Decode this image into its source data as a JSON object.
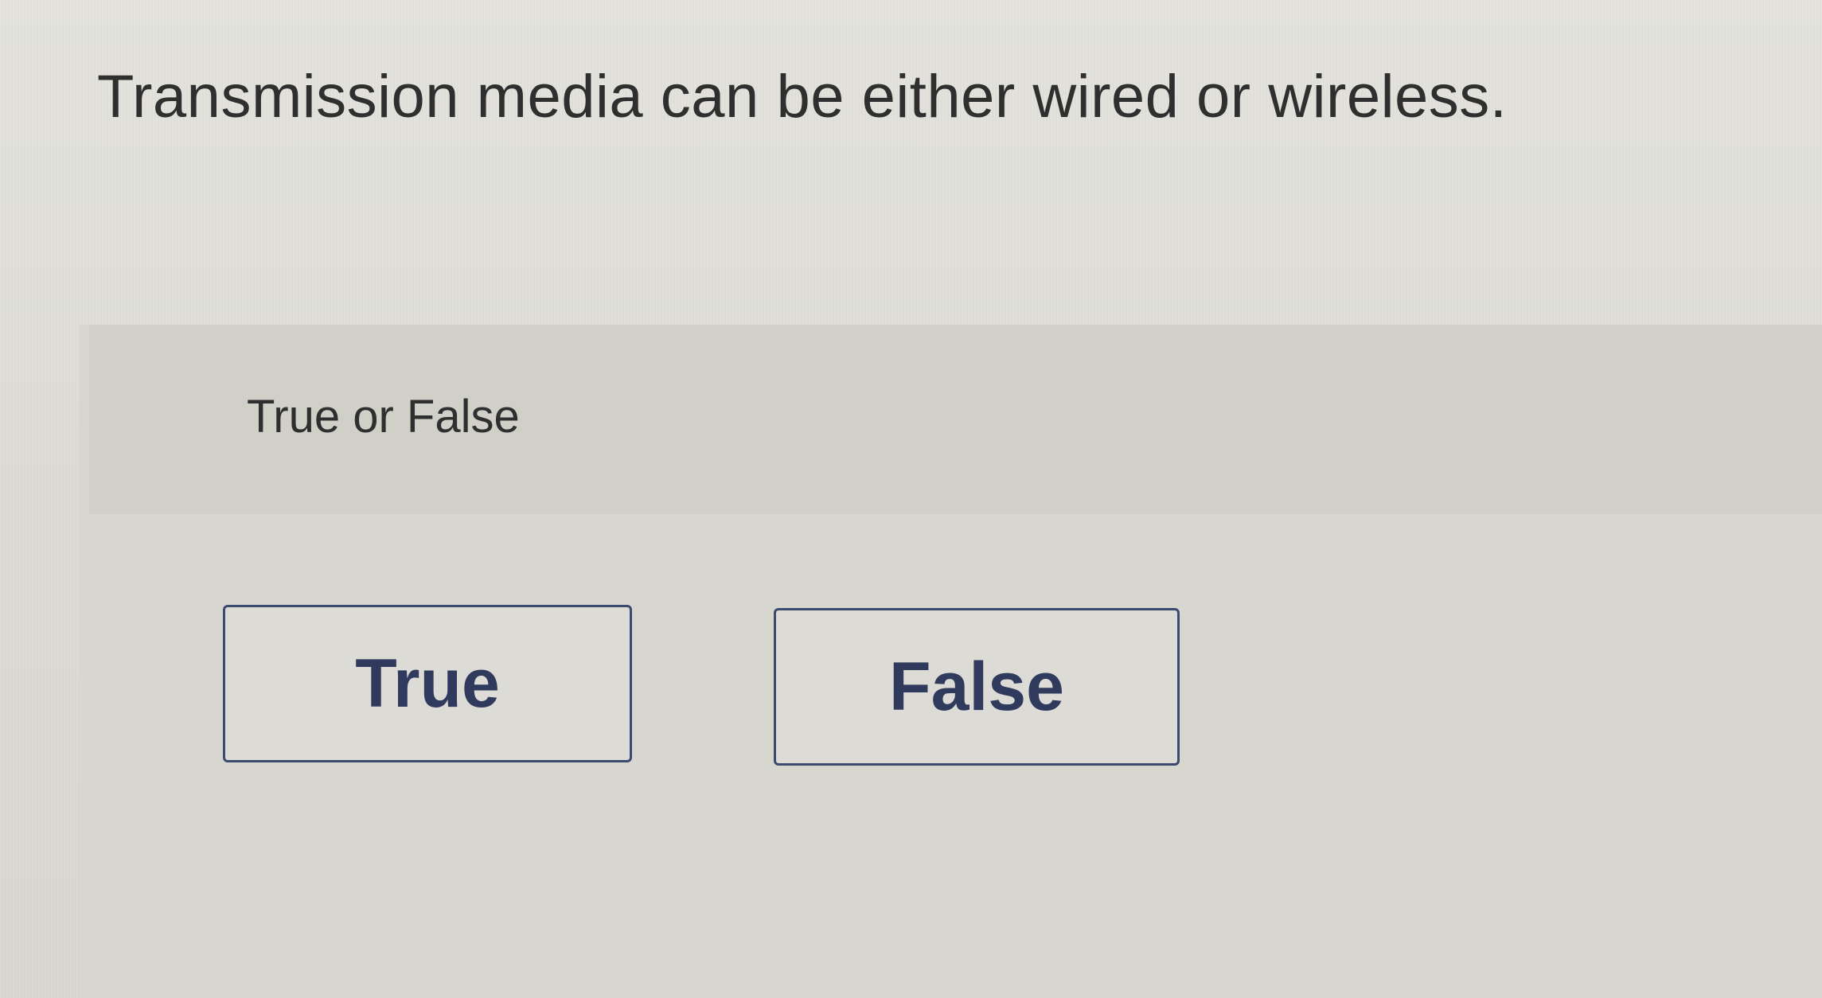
{
  "question": {
    "text": "Transmission media can be either wired or wireless."
  },
  "prompt": {
    "label": "True or False"
  },
  "choices": [
    {
      "label": "True"
    },
    {
      "label": "False"
    }
  ]
}
